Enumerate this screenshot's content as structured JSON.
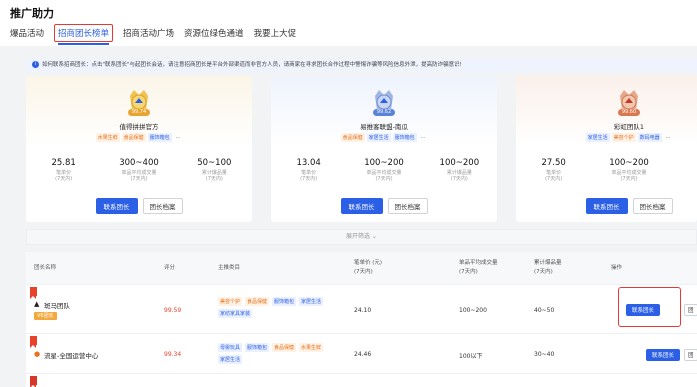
{
  "page": {
    "title": "推广助力"
  },
  "tabs": [
    {
      "label": "爆品活动"
    },
    {
      "label": "招商团长榜单",
      "active": true
    },
    {
      "label": "招商活动广场"
    },
    {
      "label": "资源位绿色通道"
    },
    {
      "label": "我要上大促"
    }
  ],
  "notice": {
    "text": "如何联系招商团长：点击\"联系团长\"与起团长会话，请注意招商团长是平台外部渠道而非官方人员，请商家在寻求团长合作过程中警惕诈骗等风险信息外泄，提高防诈骗意识!"
  },
  "cards": [
    {
      "score": "99.74",
      "name": "值得拼拼官方",
      "tags": [
        "水果生鲜",
        "食品保健",
        "服饰箱包"
      ],
      "more": "···",
      "stats": [
        {
          "value": "25.81",
          "label": "笔单价\n(7天内)"
        },
        {
          "value": "300~400",
          "label": "单品平均成交量\n(7天内)"
        },
        {
          "value": "50~100",
          "label": "累计爆品量\n(7天内)"
        }
      ],
      "contact_label": "联系团长",
      "profile_label": "团长档案"
    },
    {
      "score": "99.62",
      "name": "易推客联盟-南瓜",
      "tags": [
        "食品保健",
        "家居生活",
        "服饰箱包"
      ],
      "more": "···",
      "stats": [
        {
          "value": "13.04",
          "label": "笔单价\n(7天内)"
        },
        {
          "value": "100~200",
          "label": "单品平均成交量\n(7天内)"
        },
        {
          "value": "100~200",
          "label": "累计爆品量\n(7天内)"
        }
      ],
      "contact_label": "联系团长",
      "profile_label": "团长档案"
    },
    {
      "score": "99.60",
      "name": "彩虹团队1",
      "tags": [
        "家居生活",
        "美容个护",
        "数码电器"
      ],
      "more": "···",
      "stats": [
        {
          "value": "27.50",
          "label": "笔单价\n(7天内)"
        },
        {
          "value": "100~200",
          "label": "单品平均成交量\n(7天内)"
        },
        {
          "value": "",
          "label": ""
        }
      ],
      "contact_label": "联系团长",
      "profile_label": "团长档案"
    }
  ],
  "expand": {
    "label": "展开筛选"
  },
  "table": {
    "headers": {
      "name": "团长名称",
      "score": "评分",
      "category": "主推类目",
      "price": "笔单价 (元)\n(7天内)",
      "avg_volume": "单品平均成交量\n(7天内)",
      "total": "累计爆品量\n(7天内)",
      "action": "操作"
    },
    "rows": [
      {
        "name": "斑马团队",
        "badge": "V6团长",
        "score": "99.59",
        "categories": [
          "美容个护",
          "食品保健",
          "服饰箱包",
          "家居生活",
          "家纺家具家装"
        ],
        "price": "24.10",
        "avg_volume": "100~200",
        "total": "40~50",
        "contact_label": "联系团长",
        "second_label": "团"
      },
      {
        "name": "流星-全国运营中心",
        "badge": "",
        "score": "99.34",
        "categories": [
          "母婴玩具",
          "服饰箱包",
          "食品保健",
          "水果生鲜",
          "家居生活"
        ],
        "price": "24.46",
        "avg_volume": "100以下",
        "total": "30~40",
        "contact_label": "联系团长",
        "second_label": "团"
      }
    ]
  },
  "colors": {
    "primary": "#2b5fe6",
    "highlight_border": "#e53935",
    "score_red": "#e8412c"
  }
}
